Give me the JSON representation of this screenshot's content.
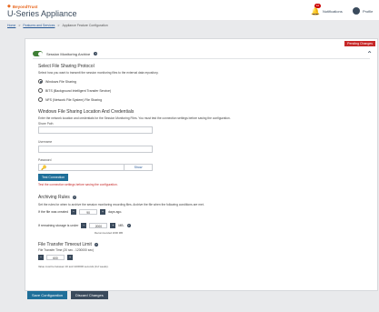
{
  "brand": {
    "logo_text": "BeyondTrust",
    "app_title": "U-Series Appliance"
  },
  "breadcrumb": {
    "home": "Home",
    "features": "Features and Services",
    "current": "Appliance Feature Configuration",
    "sep": ">"
  },
  "header_right": {
    "notif_count": "10",
    "notifications": "Notifications",
    "profile": "Profile"
  },
  "panel": {
    "pending": "Pending Changes",
    "section_title": "Session Monitoring Archive",
    "file_sharing": {
      "heading": "Select File Sharing Protocol",
      "note": "Select how you want to transmit the session monitoring files to the external data repository.",
      "options": [
        "Windows File Sharing",
        "BITS (Background Intelligent Transfer Service)",
        "NFS (Network File System) File Sharing"
      ]
    },
    "location": {
      "heading": "Windows File Sharing Location And Credentials",
      "note": "Enter the network location and credentials for the Session Monitoring Files. You must test the connection settings before saving the configuration.",
      "share_path_label": "Share Path",
      "username_label": "Username",
      "password_label": "Password",
      "show": "Show",
      "test_button": "Test Connection",
      "test_note": "Test the connection settings before saving the configuration."
    },
    "archiving": {
      "heading": "Archiving Rules",
      "note": "Set the rules for when to archive the session monitoring recording files. Archive the file when the following conditions are met.",
      "row1_pre": "If the file was created",
      "row1_val": "90",
      "row1_post": "days ago.",
      "row2_pre": "If remaining storage is under",
      "row2_val": "2000",
      "row2_post": "MB.",
      "recommended": "Recommended 2000 MB"
    },
    "transfer": {
      "heading": "File Transfer Timeout Limit",
      "sub": "File Transfer Time (20 sec - 1200000 sec)",
      "val": "600",
      "note": "Value must be between 20 and 1200000 seconds (0-2 weeks)."
    }
  },
  "footer": {
    "save": "Save Configuration",
    "discard": "Discard Changes"
  }
}
